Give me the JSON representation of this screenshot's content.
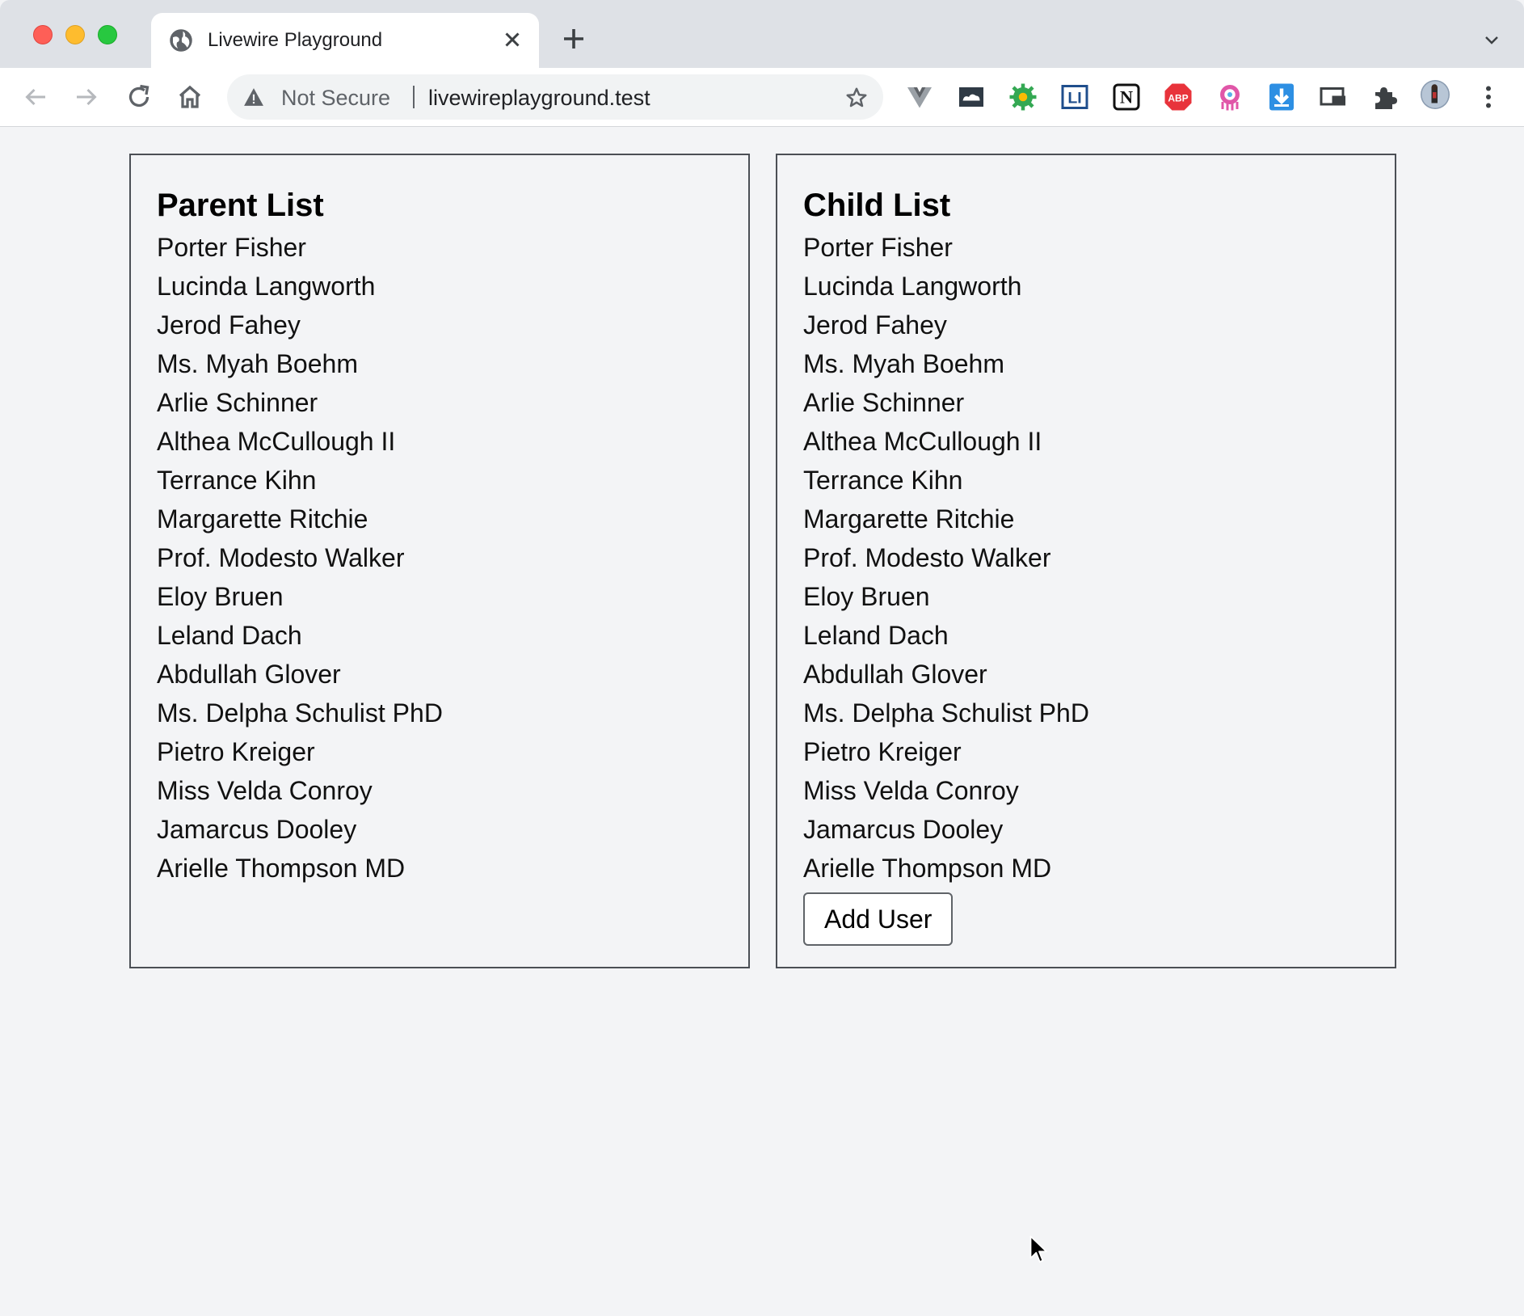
{
  "browser": {
    "tab_title": "Livewire Playground",
    "security_label": "Not Secure",
    "url": "livewireplayground.test",
    "extensions": [
      {
        "name": "vue-devtools-icon",
        "label": ""
      },
      {
        "name": "cloud-extension-icon",
        "label": ""
      },
      {
        "name": "gear-extension-icon",
        "label": ""
      },
      {
        "name": "li-extension-icon",
        "label": "LI"
      },
      {
        "name": "notion-icon",
        "label": "N"
      },
      {
        "name": "adblock-plus-icon",
        "label": "ABP"
      },
      {
        "name": "octopus-extension-icon",
        "label": ""
      },
      {
        "name": "download-extension-icon",
        "label": ""
      },
      {
        "name": "cast-icon",
        "label": ""
      },
      {
        "name": "puzzle-icon",
        "label": ""
      },
      {
        "name": "profile-avatar",
        "label": ""
      }
    ]
  },
  "parent_list": {
    "title": "Parent List",
    "items": [
      "Porter Fisher",
      "Lucinda Langworth",
      "Jerod Fahey",
      "Ms. Myah Boehm",
      "Arlie Schinner",
      "Althea McCullough II",
      "Terrance Kihn",
      "Margarette Ritchie",
      "Prof. Modesto Walker",
      "Eloy Bruen",
      "Leland Dach",
      "Abdullah Glover",
      "Ms. Delpha Schulist PhD",
      "Pietro Kreiger",
      "Miss Velda Conroy",
      "Jamarcus Dooley",
      "Arielle Thompson MD"
    ]
  },
  "child_list": {
    "title": "Child List",
    "items": [
      "Porter Fisher",
      "Lucinda Langworth",
      "Jerod Fahey",
      "Ms. Myah Boehm",
      "Arlie Schinner",
      "Althea McCullough II",
      "Terrance Kihn",
      "Margarette Ritchie",
      "Prof. Modesto Walker",
      "Eloy Bruen",
      "Leland Dach",
      "Abdullah Glover",
      "Ms. Delpha Schulist PhD",
      "Pietro Kreiger",
      "Miss Velda Conroy",
      "Jamarcus Dooley",
      "Arielle Thompson MD"
    ],
    "add_button_label": "Add User"
  },
  "colors": {
    "page_bg": "#f3f4f6",
    "panel_border": "#4b4f55",
    "chrome_bg": "#dee1e6"
  }
}
